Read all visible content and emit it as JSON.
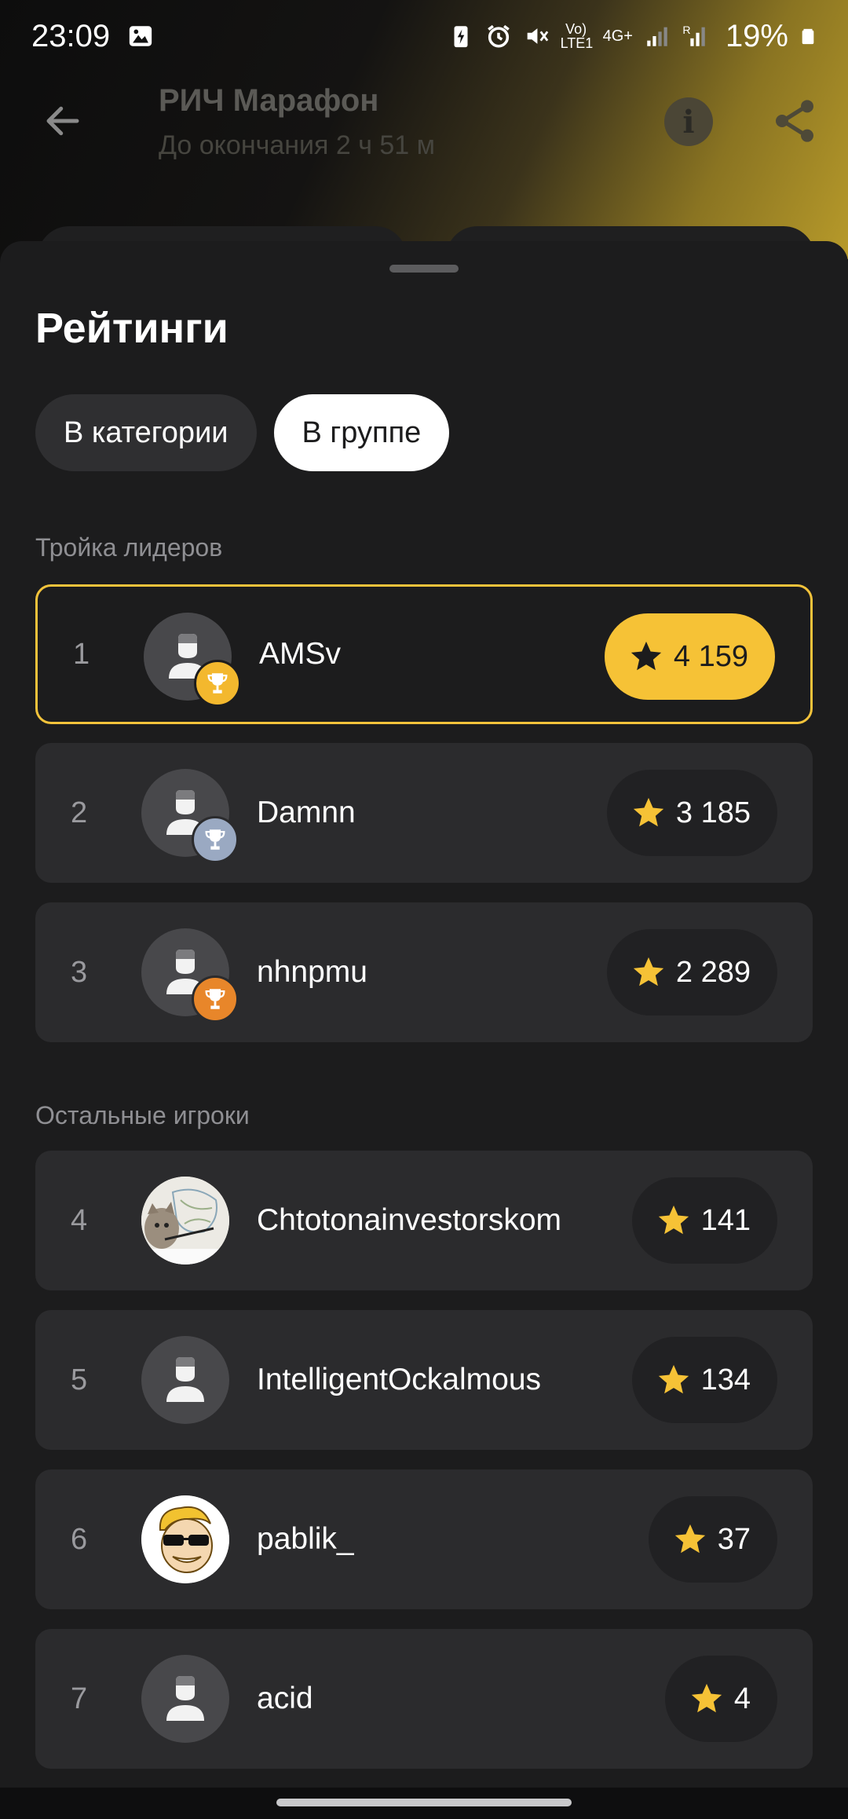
{
  "status_bar": {
    "time": "23:09",
    "network_1": "Vo) LTE1",
    "network_2": "4G+",
    "battery": "19%"
  },
  "header": {
    "title": "РИЧ Марафон",
    "subtitle": "До окончания 2 ч 51 м"
  },
  "sheet": {
    "title": "Рейтинги",
    "tabs": [
      {
        "label": "В категории",
        "active": false
      },
      {
        "label": "В группе",
        "active": true
      }
    ],
    "leaders_label": "Тройка лидеров",
    "others_label": "Остальные игроки",
    "leaders": [
      {
        "rank": "1",
        "name": "AMSv",
        "score": "4 159",
        "trophy": "gold"
      },
      {
        "rank": "2",
        "name": "Damnn",
        "score": "3 185",
        "trophy": "silver"
      },
      {
        "rank": "3",
        "name": "nhnpmu",
        "score": "2 289",
        "trophy": "bronze"
      }
    ],
    "others": [
      {
        "rank": "4",
        "name": "Chtotonainvestorskom",
        "score": "141",
        "avatar": "cat-photo"
      },
      {
        "rank": "5",
        "name": "IntelligentOckalmous",
        "score": "134",
        "avatar": "default"
      },
      {
        "rank": "6",
        "name": "pablik_",
        "score": "37",
        "avatar": "cartoon-sunglasses"
      },
      {
        "rank": "7",
        "name": "acid",
        "score": "4",
        "avatar": "default"
      }
    ]
  },
  "colors": {
    "accent": "#f6c236",
    "gold_trophy": "#f3b82e",
    "silver_trophy": "#9aa9c2",
    "bronze_trophy": "#e8862a"
  }
}
